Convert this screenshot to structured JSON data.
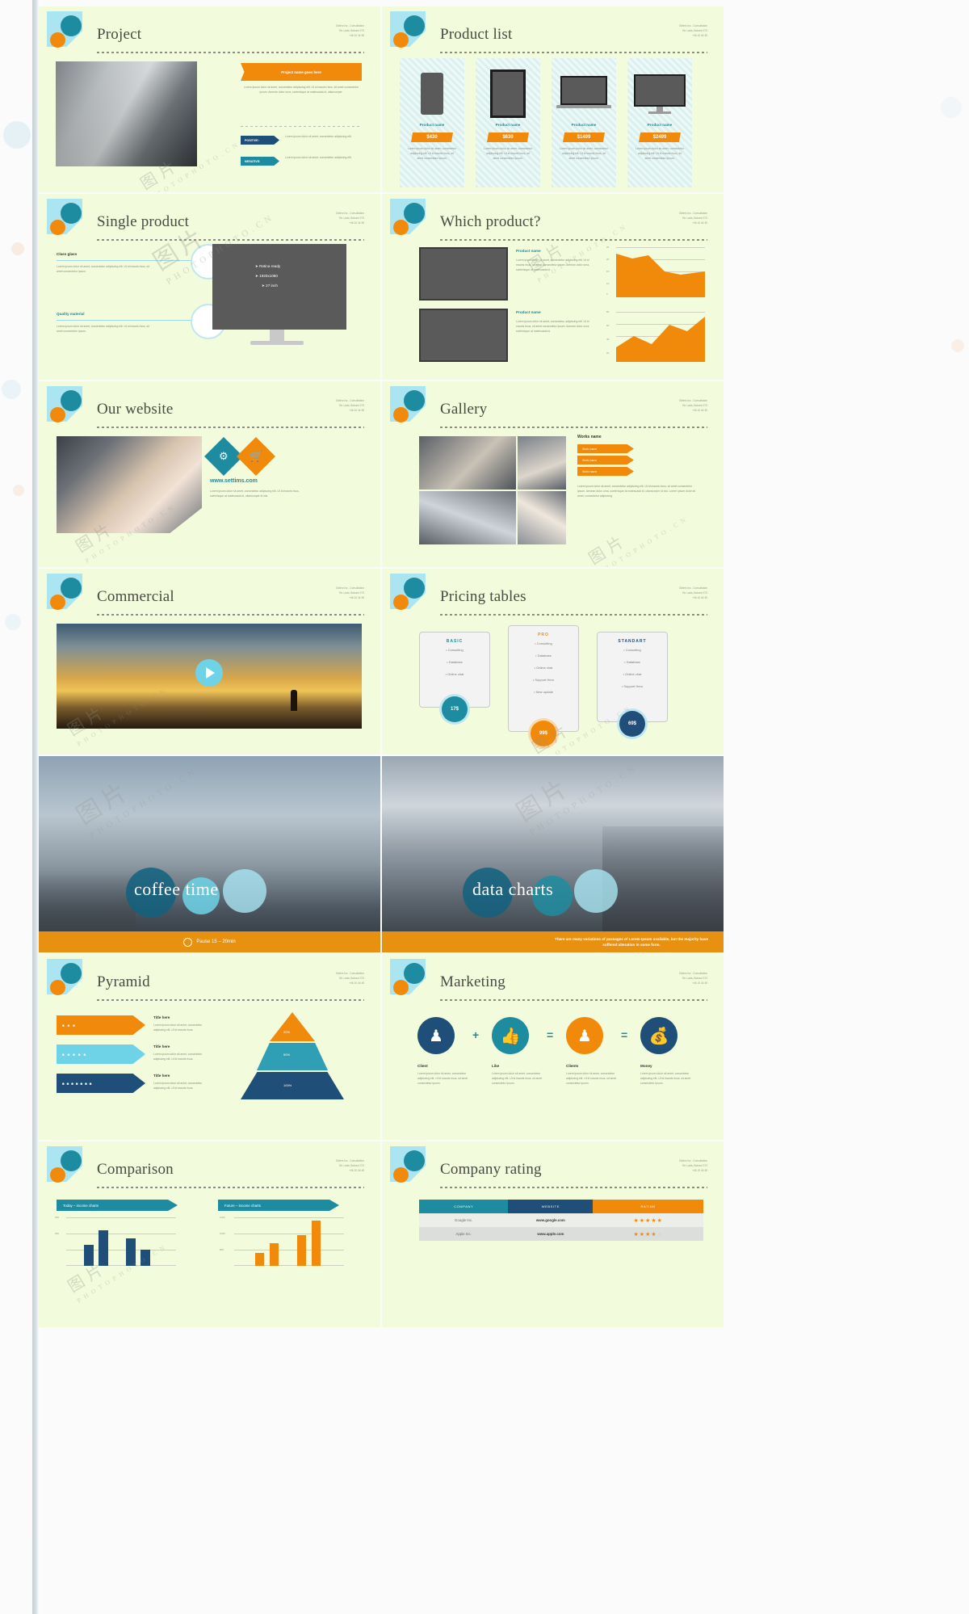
{
  "meta": {
    "contact": [
      "Odiers Inc - Consultation",
      "Str. Lada, Botosvi 373",
      "+46 10 44 45"
    ],
    "watermark_cjk": "图片",
    "watermark_lat": "PHOTOPHOTO.CN"
  },
  "slides": [
    {
      "id": "project",
      "title": "Project",
      "banner": "Project name goes here",
      "body": "Lorem ipsum dolor sit amet, consectetur adipiscing elit. Ut id mauris risus, sit amet consectetur ipsum. Aenean dolor urna, scelerisque at malesuada id, ullamcorper.",
      "tags": [
        {
          "label": "POSITIVE:",
          "color": "#1f4e79",
          "text": "Lorem ipsum dolor sit amet, consectetur adipiscing elit."
        },
        {
          "label": "NEGATIVE:",
          "color": "#1e8ca0",
          "text": "Lorem ipsum dolor sit amet, consectetur adipiscing elit."
        }
      ]
    },
    {
      "id": "product-list",
      "title": "Product list",
      "products": [
        {
          "name": "Product name",
          "price": "$430",
          "desc": "Lorem ipsum dolor sit amet, consectetur adipiscing elit. Ut id mauris risus, sit amet consectetur ipsum.",
          "device": "phone"
        },
        {
          "name": "Product name",
          "price": "$630",
          "desc": "Lorem ipsum dolor sit amet, consectetur adipiscing elit. Ut id mauris risus, sit amet consectetur ipsum.",
          "device": "tablet"
        },
        {
          "name": "Product name",
          "price": "$1499",
          "desc": "Lorem ipsum dolor sit amet, consectetur adipiscing elit. Ut id mauris risus, sit amet consectetur ipsum.",
          "device": "laptop"
        },
        {
          "name": "Product name",
          "price": "$2499",
          "desc": "Lorem ipsum dolor sit amet, consectetur adipiscing elit. Ut id mauris risus, sit amet consectetur ipsum.",
          "device": "desktop"
        }
      ]
    },
    {
      "id": "single-product",
      "title": "Single product",
      "features": [
        {
          "label": "Class glass",
          "text": "Lorem ipsum dolor sit amet, consectetur adipiscing elit. Ut id mauris risus, sit amet consectetur ipsum."
        },
        {
          "label": "Quality material",
          "text": "Lorem ipsum dolor sit amet, consectetur adipiscing elit. Ut id mauris risus, sit amet consectetur ipsum."
        }
      ],
      "specs": [
        "Retina ready",
        "1920x1080",
        "27 inch"
      ]
    },
    {
      "id": "which-product",
      "title": "Which product?",
      "items": [
        {
          "name": "Product name",
          "text": "Lorem ipsum dolor sit amet, consectetur adipiscing elit. Ut id mauris risus, sit amet consectetur ipsum. Aenean dolor urna, scelerisque at malesuada id."
        },
        {
          "name": "Product name",
          "text": "Lorem ipsum dolor sit amet, consectetur adipiscing elit. Ut id mauris risus, sit amet consectetur ipsum. Aenean dolor urna, scelerisque at malesuada id."
        }
      ],
      "chart_ticks_top": [
        "25",
        "20",
        "15",
        "10",
        "5"
      ],
      "chart_ticks_bottom": [
        "80",
        "60",
        "40",
        "20"
      ]
    },
    {
      "id": "our-website",
      "title": "Our website",
      "url": "www.settims.com",
      "body": "Lorem ipsum dolor sit amet, consectetur adipiscing elit. Ut id mauris risus, scelerisque at malesuada id, ullamcorper id nisi.",
      "icons": [
        "wrench-icon",
        "cart-icon"
      ]
    },
    {
      "id": "gallery",
      "title": "Gallery",
      "works_title": "Works name",
      "works": [
        "Work name",
        "Work name",
        "Work name"
      ],
      "body": "Lorem ipsum dolor sit amet, consectetur adipiscing elit. Ut id mauris risus, sit amet consectetur ipsum. Aenean dolor urna, scelerisque at malesuada id, ullamcorper id nisi. Lorem ipsum dolor sit amet, consectetur adipiscing."
    },
    {
      "id": "commercial",
      "title": "Commercial",
      "play": "play-icon"
    },
    {
      "id": "pricing-tables",
      "title": "Pricing tables",
      "plans": [
        {
          "name": "BASIC",
          "color": "#1e8ca0",
          "items": [
            "Consulting",
            "Database",
            "Online chat"
          ],
          "price": "17$"
        },
        {
          "name": "PRO",
          "color": "#f18a0a",
          "items": [
            "Consulting",
            "Database",
            "Online chat",
            "Support Hero",
            "New update"
          ],
          "price": "99$"
        },
        {
          "name": "STANDART",
          "color": "#1f4e79",
          "items": [
            "Consulting",
            "Database",
            "Online chat",
            "Support Hero"
          ],
          "price": "69$"
        }
      ]
    },
    {
      "id": "coffee-time",
      "title": "coffee time",
      "bar_text": "Pause 15 – 20min",
      "bar_icon": "clock-icon"
    },
    {
      "id": "data-charts",
      "title": "data charts",
      "bar_text": "There are many variations of passages of Lorem Ipsum available, but the majority have suffered alteration in some form."
    },
    {
      "id": "pyramid",
      "title": "Pyramid",
      "bands": [
        {
          "people": 3,
          "color": "#f18a0a",
          "title": "Title here",
          "text": "Lorem ipsum dolor sit amet, consectetur adipiscing elit. Ut id mauris risus."
        },
        {
          "people": 5,
          "color": "#6fd3e8",
          "title": "Title here",
          "text": "Lorem ipsum dolor sit amet, consectetur adipiscing elit. Ut id mauris risus."
        },
        {
          "people": 7,
          "color": "#1f4e79",
          "title": "Title here",
          "text": "Lorem ipsum dolor sit amet, consectetur adipiscing elit. Ut id mauris risus."
        }
      ],
      "levels": [
        {
          "label": "20%",
          "color": "#f18a0a"
        },
        {
          "label": "50%",
          "color": "#2e9fb5"
        },
        {
          "label": "100%",
          "color": "#1f4e79"
        }
      ]
    },
    {
      "id": "marketing",
      "title": "Marketing",
      "steps": [
        {
          "icon": "person-icon",
          "glyph": "♟",
          "color": "#1f4e79",
          "label": "Client",
          "text": "Lorem ipsum dolor sit amet, consectetur adipiscing elit. Ut id mauris risus, sit amet consectetur ipsum."
        },
        {
          "icon": "thumbs-up-icon",
          "glyph": "👍",
          "color": "#1e8ca0",
          "label": "Like",
          "text": "Lorem ipsum dolor sit amet, consectetur adipiscing elit. Ut id mauris risus, sit amet consectetur ipsum."
        },
        {
          "icon": "group-icon",
          "glyph": "♟",
          "color": "#f18a0a",
          "label": "Clients",
          "text": "Lorem ipsum dolor sit amet, consectetur adipiscing elit. Ut id mauris risus, sit amet consectetur ipsum."
        },
        {
          "icon": "money-bag-icon",
          "glyph": "💰",
          "color": "#1f4e79",
          "label": "Money",
          "text": "Lorem ipsum dolor sit amet, consectetur adipiscing elit. Ut id mauris risus, sit amet consectetur ipsum."
        }
      ],
      "operators": [
        "+",
        "=",
        "="
      ]
    },
    {
      "id": "comparison",
      "title": "Comparison",
      "charts": [
        {
          "caption": "Today – income charts",
          "color": "#1e8ca0",
          "ticks": [
            "250",
            "200"
          ],
          "values": [
            120,
            200,
            160,
            90
          ]
        },
        {
          "caption": "Future – income charts",
          "color": "#1e8ca0",
          "ticks": [
            "1200",
            "1000",
            "800"
          ],
          "values": [
            300,
            500,
            700,
            1100
          ]
        }
      ]
    },
    {
      "id": "company-rating",
      "title": "Company rating",
      "columns": [
        "COMPANY",
        "WEBSITE",
        "RATING"
      ],
      "rows": [
        {
          "company": "Google Inc.",
          "website": "www.google.com",
          "rating": 5
        },
        {
          "company": "Apple Inc.",
          "website": "www.apple.com",
          "rating": 4
        }
      ]
    }
  ]
}
